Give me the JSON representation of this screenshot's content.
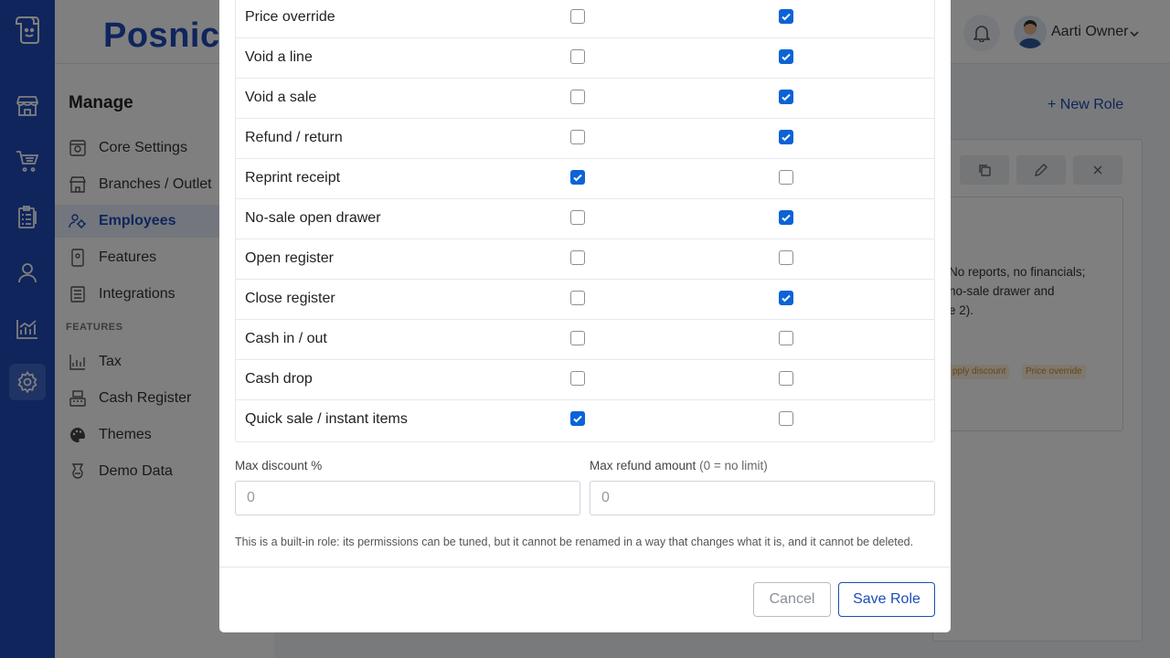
{
  "app": {
    "brand": "Posnic"
  },
  "header": {
    "user_name": "Aarti Owner",
    "icons": [
      "bell-icon",
      "avatar",
      "chevron-down-icon"
    ]
  },
  "rail": {
    "icons": [
      "logo-icon",
      "store-icon",
      "cart-icon",
      "checklist-icon",
      "user-icon",
      "chart-icon",
      "gear-icon"
    ],
    "active": "gear-icon"
  },
  "leftnav": {
    "title": "Manage",
    "items": [
      {
        "label": "Core Settings",
        "icon": "settings-panel-icon"
      },
      {
        "label": "Branches / Outlet",
        "icon": "store-icon"
      },
      {
        "label": "Employees",
        "icon": "employees-icon",
        "active": true
      },
      {
        "label": "Features",
        "icon": "feature-icon"
      },
      {
        "label": "Integrations",
        "icon": "integration-icon"
      }
    ],
    "section_label": "FEATURES",
    "feature_items": [
      {
        "label": "Tax",
        "icon": "tax-chart-icon"
      },
      {
        "label": "Cash Register",
        "icon": "register-icon"
      },
      {
        "label": "Themes",
        "icon": "palette-icon"
      },
      {
        "label": "Demo Data",
        "icon": "demo-data-icon"
      }
    ]
  },
  "background_page": {
    "new_role_label": "+ New Role",
    "role_description_visible": "No reports, no financials;\nno-sale drawer and\ne 2).",
    "pills": [
      "pply discount",
      "Price override"
    ]
  },
  "modal": {
    "permissions": [
      {
        "label": "Price override",
        "col1": false,
        "col2": true
      },
      {
        "label": "Void a line",
        "col1": false,
        "col2": true
      },
      {
        "label": "Void a sale",
        "col1": false,
        "col2": true
      },
      {
        "label": "Refund / return",
        "col1": false,
        "col2": true
      },
      {
        "label": "Reprint receipt",
        "col1": true,
        "col2": false
      },
      {
        "label": "No-sale open drawer",
        "col1": false,
        "col2": true
      },
      {
        "label": "Open register",
        "col1": false,
        "col2": false
      },
      {
        "label": "Close register",
        "col1": false,
        "col2": true
      },
      {
        "label": "Cash in / out",
        "col1": false,
        "col2": false
      },
      {
        "label": "Cash drop",
        "col1": false,
        "col2": false
      },
      {
        "label": "Quick sale / instant items",
        "col1": true,
        "col2": false
      }
    ],
    "max_discount": {
      "label": "Max discount %",
      "placeholder": "0"
    },
    "max_refund": {
      "label": "Max refund amount",
      "hint": "(0 = no limit)",
      "placeholder": "0"
    },
    "note": "This is a built-in role: its permissions can be tuned, but it cannot be renamed in a way that changes what it is, and it cannot be deleted.",
    "cancel_label": "Cancel",
    "save_label": "Save Role"
  },
  "colors": {
    "brand": "#1f4bb8",
    "checkbox_on": "#0b63d6",
    "overlay": "rgba(0,0,0,0.5)"
  }
}
